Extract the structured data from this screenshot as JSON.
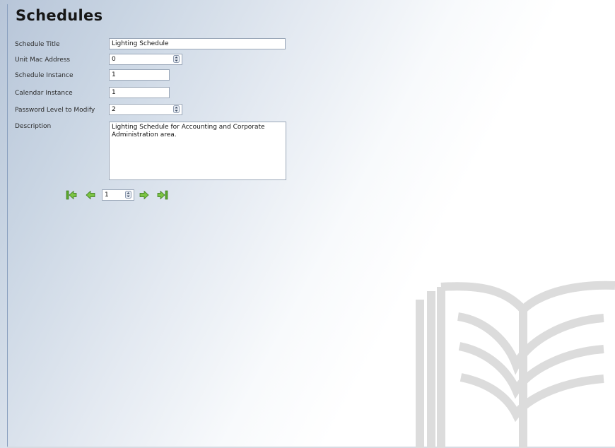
{
  "page": {
    "title": "Schedules"
  },
  "form": {
    "schedule_title": {
      "label": "Schedule Title",
      "value": "Lighting Schedule"
    },
    "unit_mac_address": {
      "label": "Unit Mac Address",
      "value": "0"
    },
    "schedule_instance": {
      "label": "Schedule Instance",
      "value": "1"
    },
    "calendar_instance": {
      "label": "Calendar Instance",
      "value": "1"
    },
    "password_level": {
      "label": "Password Level to Modify",
      "value": "2"
    },
    "description": {
      "label": "Description",
      "value": "Lighting Schedule for Accounting and Corporate\nAdministration area."
    }
  },
  "pager": {
    "record": "1",
    "icons": [
      "first-record-icon",
      "previous-record-icon",
      "next-record-icon",
      "last-record-icon"
    ]
  },
  "colors": {
    "nav_green": "#5aa82a",
    "nav_green_light": "#9bd660",
    "watermark": "#dcdcdc"
  }
}
